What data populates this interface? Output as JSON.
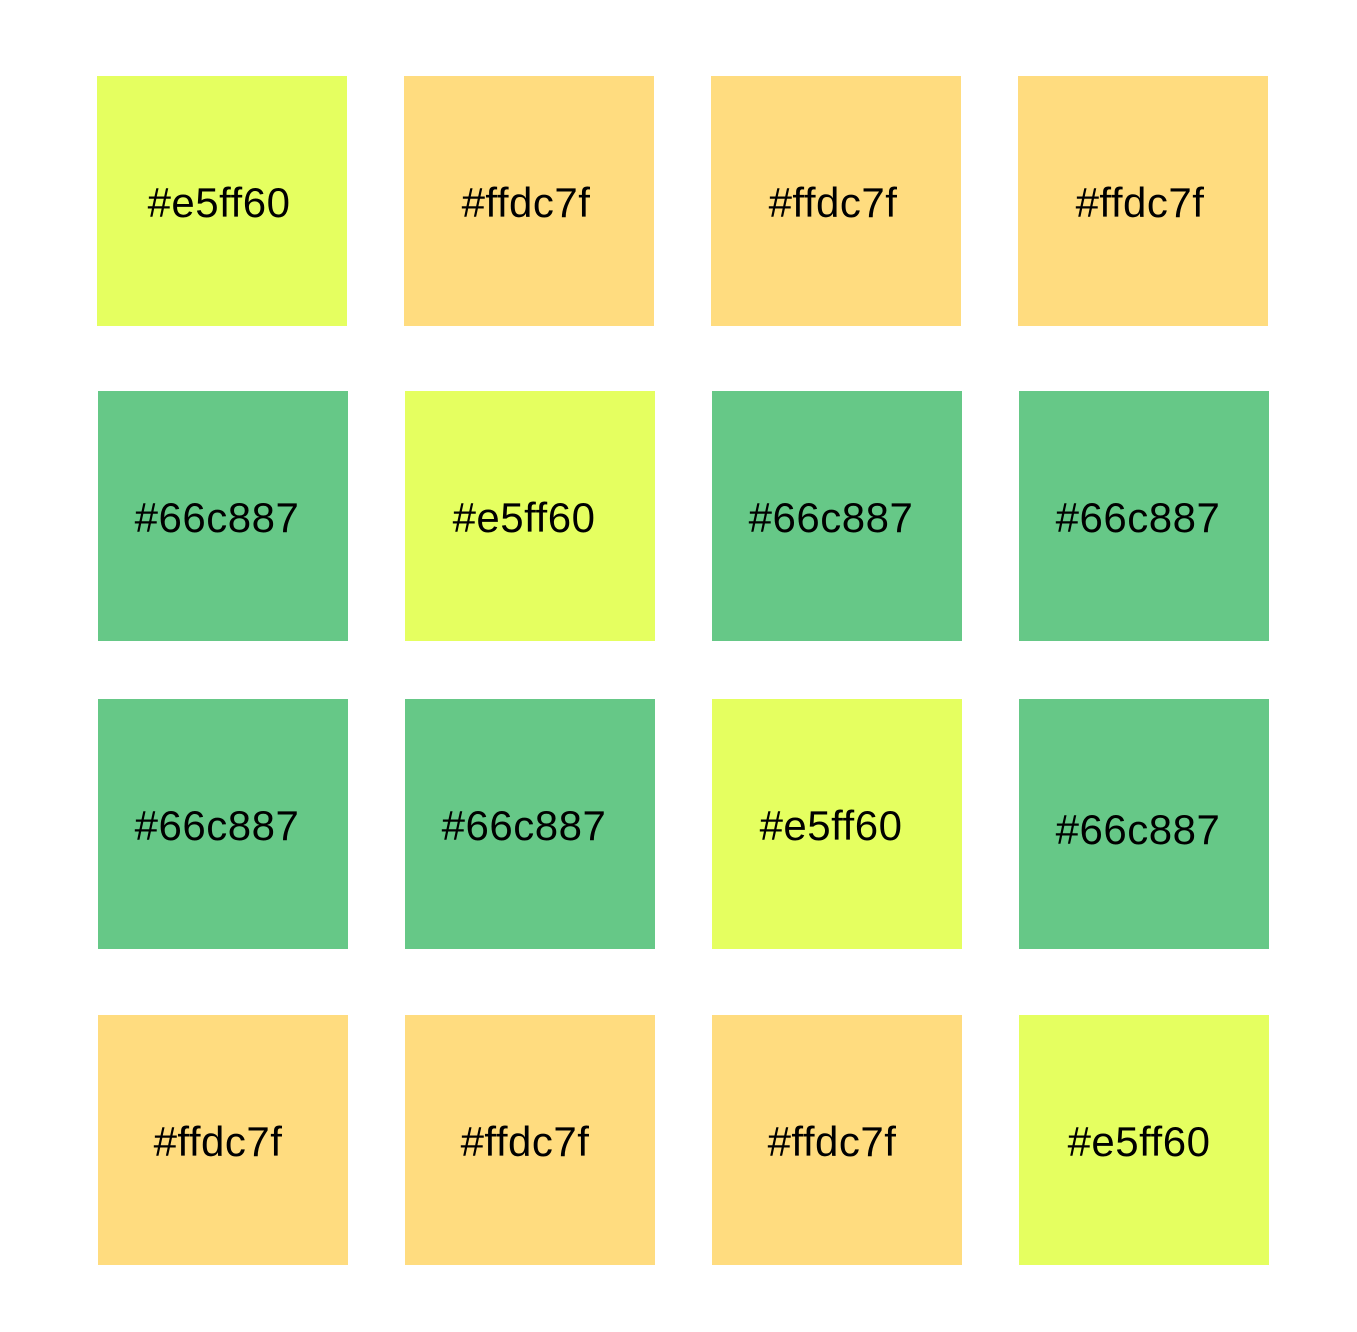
{
  "swatches": [
    {
      "label": "#e5ff60",
      "color": "#e5ff60"
    },
    {
      "label": "#ffdc7f",
      "color": "#ffdc7f"
    },
    {
      "label": "#ffdc7f",
      "color": "#ffdc7f"
    },
    {
      "label": "#ffdc7f",
      "color": "#ffdc7f"
    },
    {
      "label": "#66c887",
      "color": "#66c887"
    },
    {
      "label": "#e5ff60",
      "color": "#e5ff60"
    },
    {
      "label": "#66c887",
      "color": "#66c887"
    },
    {
      "label": "#66c887",
      "color": "#66c887"
    },
    {
      "label": "#66c887",
      "color": "#66c887"
    },
    {
      "label": "#66c887",
      "color": "#66c887"
    },
    {
      "label": "#e5ff60",
      "color": "#e5ff60"
    },
    {
      "label": "#66c887",
      "color": "#66c887"
    },
    {
      "label": "#ffdc7f",
      "color": "#ffdc7f"
    },
    {
      "label": "#ffdc7f",
      "color": "#ffdc7f"
    },
    {
      "label": "#ffdc7f",
      "color": "#ffdc7f"
    },
    {
      "label": "#e5ff60",
      "color": "#e5ff60"
    }
  ]
}
